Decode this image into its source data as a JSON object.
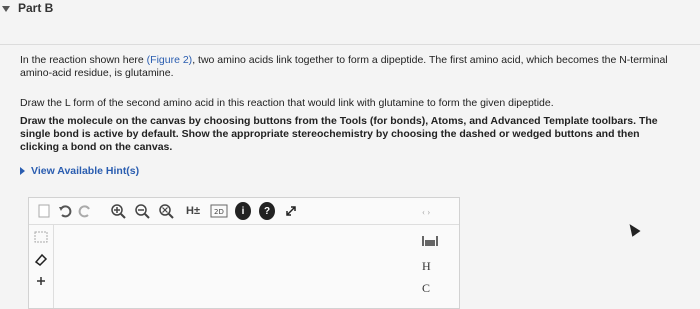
{
  "part": {
    "title": "Part B"
  },
  "intro": {
    "before": "In the reaction shown here ",
    "link": "(Figure 2)",
    "after": ", two amino acids link together to form a dipeptide. The first amino acid, which becomes the N-terminal amino-acid residue, is glutamine."
  },
  "instruction1": "Draw the L form of the second amino acid in this reaction that would link with glutamine to form the given dipeptide.",
  "instruction2": "Draw the molecule on the canvas by choosing buttons from the Tools (for bonds), Atoms, and Advanced Template toolbars. The single bond is active by default. Show the appropriate stereochemistry by choosing the dashed or wedged buttons and then clicking a bond on the canvas.",
  "hint": {
    "label": "View Available Hint(s)"
  },
  "toolbar": {
    "hplus_label": "H±",
    "info_label": "i",
    "help_label": "?"
  },
  "atoms": {
    "h": "H",
    "c": "C"
  },
  "colors": {
    "link": "#2a5db0",
    "text": "#222222",
    "background": "#f4f4f4"
  }
}
